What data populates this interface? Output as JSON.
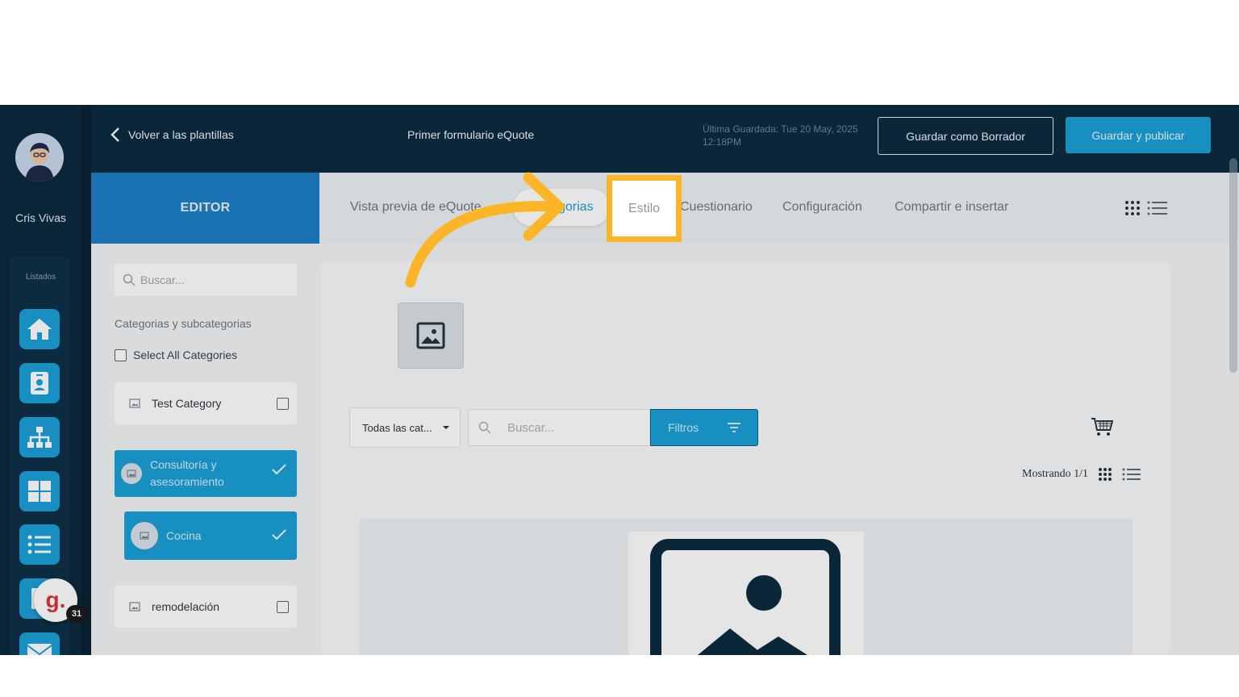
{
  "user": {
    "name": "Cris Vivas"
  },
  "rail": {
    "caption": "Listados",
    "notification_count": "31",
    "chat_letter": "g."
  },
  "header": {
    "back_label": "Volver a las plantillas",
    "form_title": "Primer formulario eQuote",
    "last_saved": "Última Guardada: Tue 20 May, 2025 12:18PM",
    "draft_button": "Guardar como Borrador",
    "publish_button": "Guardar y publicar"
  },
  "tabs": {
    "editor": "EDITOR",
    "preview": "Vista previa de eQuote",
    "categories": "Categorías",
    "categories_visible": "gorias",
    "style": "Estilo",
    "questionnaire": "Cuestionario",
    "config": "Configuración",
    "share": "Compartir e insertar"
  },
  "filter_panel": {
    "search_placeholder": "Buscar...",
    "heading": "Categorias y subcategorias",
    "select_all": "Select All Categories",
    "categories": [
      {
        "label": "Test Category",
        "selected": false
      },
      {
        "label": "Consultoría y asesoramiento",
        "selected": true
      },
      {
        "label": "Cocina",
        "selected": true
      },
      {
        "label": "remodelación",
        "selected": false
      }
    ]
  },
  "preview": {
    "category_select": "Todas las cat...",
    "search_placeholder": "Buscar...",
    "filter_button": "Filtros",
    "showing": "Mostrando 1/1"
  },
  "colors": {
    "accent": "#1aa0d6",
    "header": "#0c2b40",
    "highlight": "#fbb527"
  }
}
